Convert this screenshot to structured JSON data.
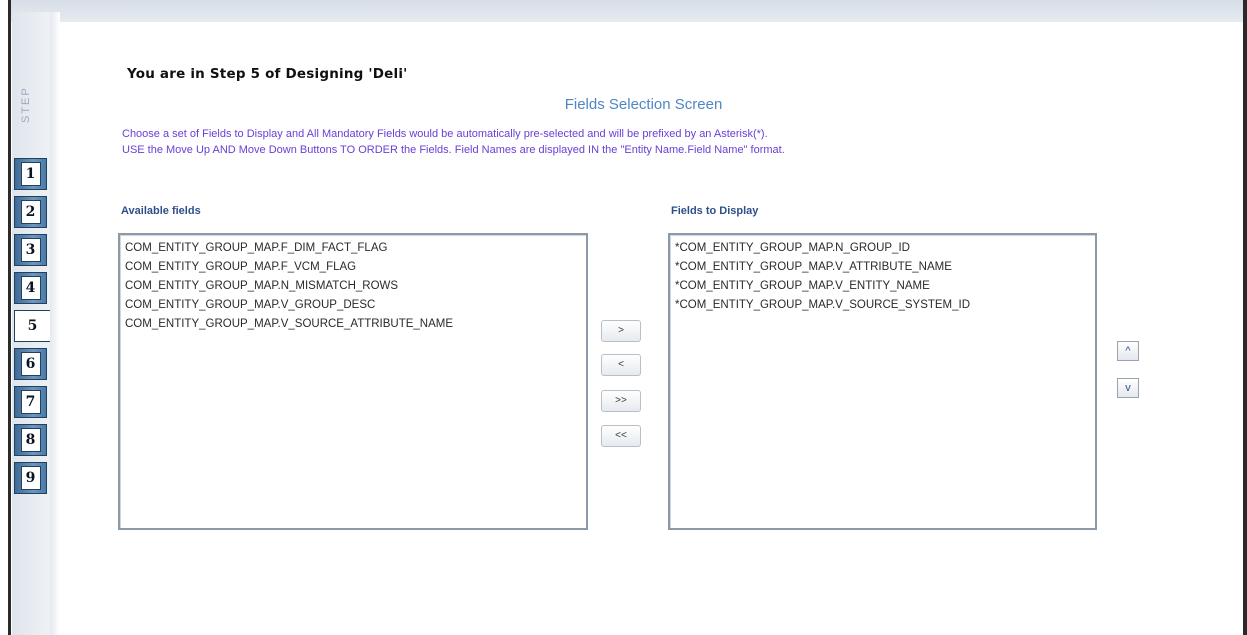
{
  "header": {
    "heading": "You are in Step 5 of Designing 'Deli'",
    "screen_title": "Fields Selection Screen",
    "instruction_line1": "Choose a set of Fields to Display and All Mandatory Fields would be automatically pre-selected and will be prefixed by an Asterisk(*).",
    "instruction_line2": "USE the Move Up AND Move Down Buttons TO ORDER the Fields. Field Names are displayed IN the \"Entity Name.Field Name\" format."
  },
  "steps": {
    "label": "STEP",
    "items": [
      "1",
      "2",
      "3",
      "4",
      "5",
      "6",
      "7",
      "8",
      "9"
    ],
    "active": "5"
  },
  "available": {
    "label": "Available fields",
    "items": [
      "COM_ENTITY_GROUP_MAP.F_DIM_FACT_FLAG",
      "COM_ENTITY_GROUP_MAP.F_VCM_FLAG",
      "COM_ENTITY_GROUP_MAP.N_MISMATCH_ROWS",
      "COM_ENTITY_GROUP_MAP.V_GROUP_DESC",
      "COM_ENTITY_GROUP_MAP.V_SOURCE_ATTRIBUTE_NAME"
    ]
  },
  "display": {
    "label": "Fields to Display",
    "items": [
      "*COM_ENTITY_GROUP_MAP.N_GROUP_ID",
      "*COM_ENTITY_GROUP_MAP.V_ATTRIBUTE_NAME",
      "*COM_ENTITY_GROUP_MAP.V_ENTITY_NAME",
      "*COM_ENTITY_GROUP_MAP.V_SOURCE_SYSTEM_ID"
    ]
  },
  "buttons": {
    "move_right": ">",
    "move_left": "<",
    "move_all_right": ">>",
    "move_all_left": "<<",
    "move_up": "^",
    "move_down": "v"
  },
  "colors": {
    "tab_blue": "#4a7aa8",
    "title_blue": "#4f86c6",
    "instruction_purple": "#6a3fd6",
    "label_navy": "#2f4f8a"
  }
}
